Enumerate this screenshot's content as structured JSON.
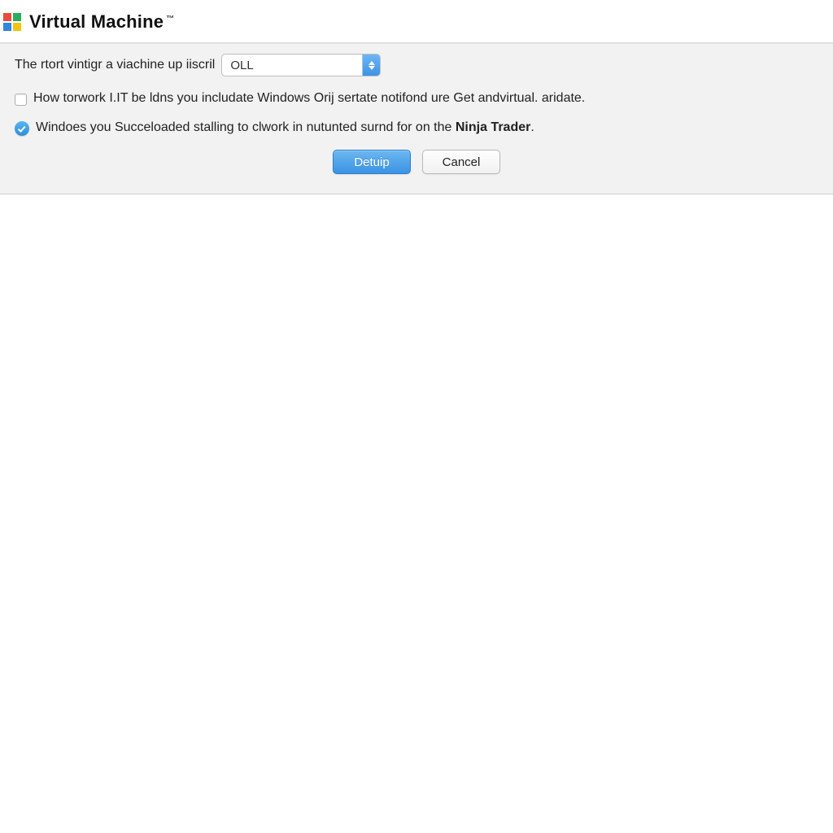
{
  "header": {
    "title": "Virtual Machine",
    "trademark": "™"
  },
  "form": {
    "row1_label": "The rtort vintigr a viachine up iiscril",
    "select_value": "OLL",
    "check1_label": "How torwork I.IT be ldns you includate Windows Orij sertate notifond ure Get andvirtual. aridate.",
    "check2_prefix": "Windoes you Succeloaded stalling to clwork in nutunted surnd for on the ",
    "check2_bold": "Ninja Trader",
    "check2_suffix": "."
  },
  "buttons": {
    "primary": "Detuip",
    "cancel": "Cancel"
  }
}
